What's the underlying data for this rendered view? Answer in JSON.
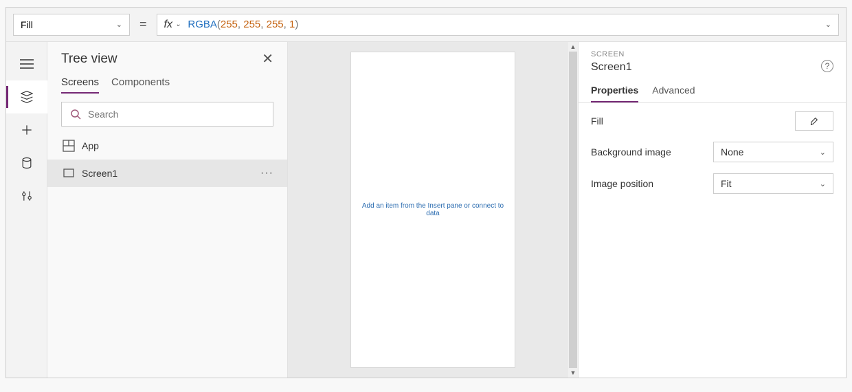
{
  "formula_bar": {
    "property": "Fill",
    "fx_label": "fx",
    "equals": "=",
    "function_name": "RGBA",
    "args": [
      "255",
      "255",
      "255",
      "1"
    ]
  },
  "tree_view": {
    "title": "Tree view",
    "tabs": {
      "screens": "Screens",
      "components": "Components"
    },
    "search_placeholder": "Search",
    "items": [
      {
        "label": "App",
        "selected": false,
        "icon": "app"
      },
      {
        "label": "Screen1",
        "selected": true,
        "icon": "screen"
      }
    ],
    "more_label": "···"
  },
  "canvas": {
    "hint": "Add an item from the Insert pane or connect to data"
  },
  "properties": {
    "type_label": "SCREEN",
    "name": "Screen1",
    "tabs": {
      "properties": "Properties",
      "advanced": "Advanced"
    },
    "rows": {
      "fill_label": "Fill",
      "bg_label": "Background image",
      "bg_value": "None",
      "pos_label": "Image position",
      "pos_value": "Fit"
    }
  }
}
